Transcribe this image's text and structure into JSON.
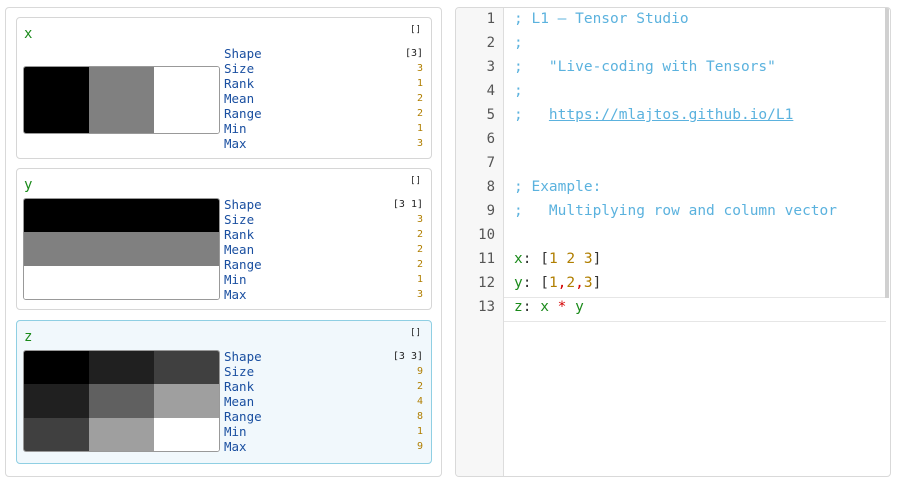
{
  "variables": [
    {
      "name": "x",
      "menu_icon": "[]",
      "grid": {
        "rows": 1,
        "cols": 3,
        "values": [
          [
            1,
            2,
            3
          ]
        ],
        "min": 1,
        "max": 3
      },
      "stats": {
        "shape": "[3]",
        "size": "3",
        "rank": "1",
        "mean": "2",
        "range": "2",
        "min": "1",
        "max": "3"
      }
    },
    {
      "name": "y",
      "menu_icon": "[]",
      "grid": {
        "rows": 3,
        "cols": 1,
        "values": [
          [
            1
          ],
          [
            2
          ],
          [
            3
          ]
        ],
        "min": 1,
        "max": 3
      },
      "stats": {
        "shape": "[3 1]",
        "size": "3",
        "rank": "2",
        "mean": "2",
        "range": "2",
        "min": "1",
        "max": "3"
      }
    },
    {
      "name": "z",
      "menu_icon": "[]",
      "selected": true,
      "grid": {
        "rows": 3,
        "cols": 3,
        "values": [
          [
            1,
            2,
            3
          ],
          [
            2,
            4,
            6
          ],
          [
            3,
            6,
            9
          ]
        ],
        "min": 1,
        "max": 9
      },
      "stats": {
        "shape": "[3 3]",
        "size": "9",
        "rank": "2",
        "mean": "4",
        "range": "8",
        "min": "1",
        "max": "9"
      }
    }
  ],
  "stat_labels": {
    "shape": "Shape",
    "size": "Size",
    "rank": "Rank",
    "mean": "Mean",
    "range": "Range",
    "min": "Min",
    "max": "Max"
  },
  "editor": {
    "line_numbers": [
      "1",
      "2",
      "3",
      "4",
      "5",
      "6",
      "7",
      "8",
      "9",
      "10",
      "11",
      "12",
      "13"
    ],
    "lines": {
      "l1": "; L1 — Tensor Studio",
      "l2": ";",
      "l3": ";   \"Live-coding with Tensors\"",
      "l4": ";",
      "l5_prefix": ";   ",
      "l5_link": "https://mlajtos.github.io/L1",
      "l8": "; Example:",
      "l9": ";   Multiplying row and column vector",
      "l11": {
        "name": "x",
        "colon": ":",
        "open": " [",
        "a": "1",
        "s1": " ",
        "b": "2",
        "s2": " ",
        "c": "3",
        "close": "]"
      },
      "l12": {
        "name": "y",
        "colon": ":",
        "open": " [",
        "a": "1",
        "s1": ",",
        "b": "2",
        "s2": ",",
        "c": "3",
        "close": "]"
      },
      "l13": {
        "name": "z",
        "colon": ":",
        "sp": " ",
        "lhs": "x",
        "op": " * ",
        "rhs": "y"
      }
    }
  },
  "colors": {
    "comment": "#5bb2de",
    "identifier": "#1a8a1a",
    "number": "#b07e00",
    "operator": "#d40000",
    "stat_label": "#1a4fa0",
    "selected_card_bg": "#f1f8fc"
  }
}
